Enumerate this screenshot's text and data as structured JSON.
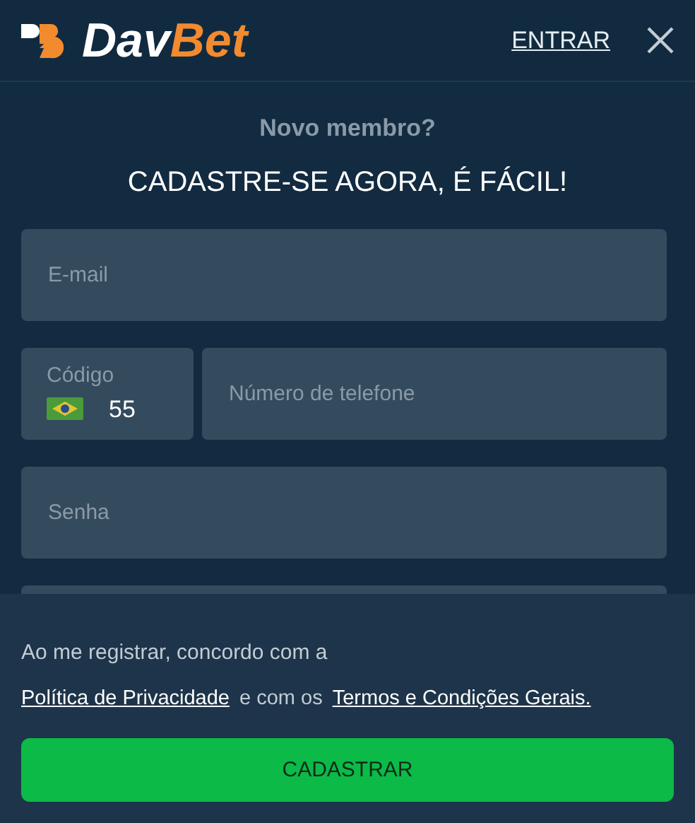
{
  "header": {
    "brand": {
      "primary": "Dav",
      "accent": "Bet"
    },
    "login_link": "ENTRAR"
  },
  "intro": {
    "subtitle": "Novo membro?",
    "title": "CADASTRE-SE AGORA, É FÁCIL!"
  },
  "fields": [
    {
      "kind": "text",
      "placeholder": "E-mail"
    },
    {
      "kind": "phone",
      "code_label": "Código",
      "code_value": "55",
      "placeholder": "Número de telefone"
    },
    {
      "kind": "text",
      "placeholder": "Senha"
    },
    {
      "kind": "text"
    }
  ],
  "footer": {
    "consent_text": "Ao me registrar, concordo com a",
    "privacy_link": "Política de Privacidade",
    "joiner": "e com os",
    "terms_link": "Termos e Condições Gerais.",
    "submit_button": "CADASTRAR"
  }
}
